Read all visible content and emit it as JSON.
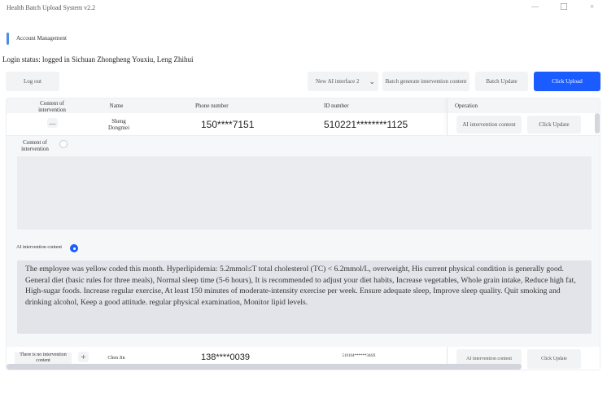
{
  "window": {
    "title": "Health Batch Upload System v2.2",
    "minimize": "—",
    "maximize": "☐",
    "close": "×"
  },
  "section": {
    "title": "Account Management",
    "accent": "#4a90e2"
  },
  "login_status": "Login status: logged in Sichuan Zhongheng Youxiu, Leng Zhihui",
  "toolbar": {
    "logout": "Log out",
    "interface_select": "New AI interface 2",
    "batch_generate": "Batch generate intervention content",
    "batch_update": "Batch Update",
    "click_upload": "Click Upload",
    "primary_color": "#1a5cff"
  },
  "table": {
    "headers": [
      "Content of intervention",
      "Name",
      "Phone number",
      "ID number",
      "Operation"
    ],
    "rows": [
      {
        "content_toggle": "—",
        "content_label": "",
        "name": "Sheng Dongmei",
        "phone": "150****7151",
        "id": "510221********1125",
        "ai_button": "AI intervention content",
        "update_button": "Click Update"
      },
      {
        "content_toggle": "+",
        "content_label": "There is no intervention content",
        "name": "Chen Jin",
        "phone": "138****0039",
        "id": "510104******346X",
        "ai_button": "AI intervention content",
        "update_button": "Click Update"
      }
    ]
  },
  "expanded": {
    "content_label": "Content of intervention",
    "content_selected": false,
    "content_value": "",
    "ai_label": "AI intervention content",
    "ai_selected": true,
    "ai_text": "The employee was yellow coded this month. Hyperlipidemia: 5.2mmol≤T total cholesterol (TC) < 6.2mmol/L, overweight, His current physical condition is generally good. General diet (basic rules for three meals), Normal sleep time (5-6 hours), It is recommended to adjust your diet habits, Increase vegetables, Whole grain intake, Reduce high fat, High-sugar foods. Increase regular exercise, At least 150 minutes of moderate-intensity exercise per week. Ensure adequate sleep, Improve sleep quality. Quit smoking and drinking alcohol, Keep a good attitude. regular physical examination, Monitor lipid levels."
  }
}
